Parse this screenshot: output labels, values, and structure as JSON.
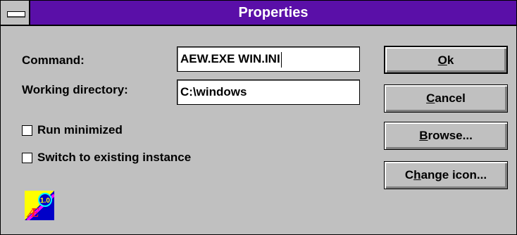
{
  "window": {
    "title": "Properties"
  },
  "form": {
    "command_label": "Command:",
    "command_value": "AEW.EXE WIN.INI",
    "workdir_label": "Working directory:",
    "workdir_value": "C:\\windows",
    "run_minimized_label": "Run minimized",
    "run_minimized_checked": false,
    "switch_existing_label": "Switch to existing instance",
    "switch_existing_checked": false
  },
  "buttons": {
    "ok": {
      "mnemonic": "O",
      "rest": "k"
    },
    "cancel": {
      "mnemonic": "C",
      "rest": "ancel"
    },
    "browse": {
      "mnemonic": "B",
      "rest": "rowse..."
    },
    "change_icon": {
      "pre": "C",
      "mnemonic": "h",
      "rest": "ange icon..."
    }
  },
  "program_icon": {
    "name": "aew-program-icon",
    "badge": "1.0",
    "letters": "Æ"
  },
  "colors": {
    "titlebar": "#5a0fa8",
    "face": "#c0c0c0"
  }
}
